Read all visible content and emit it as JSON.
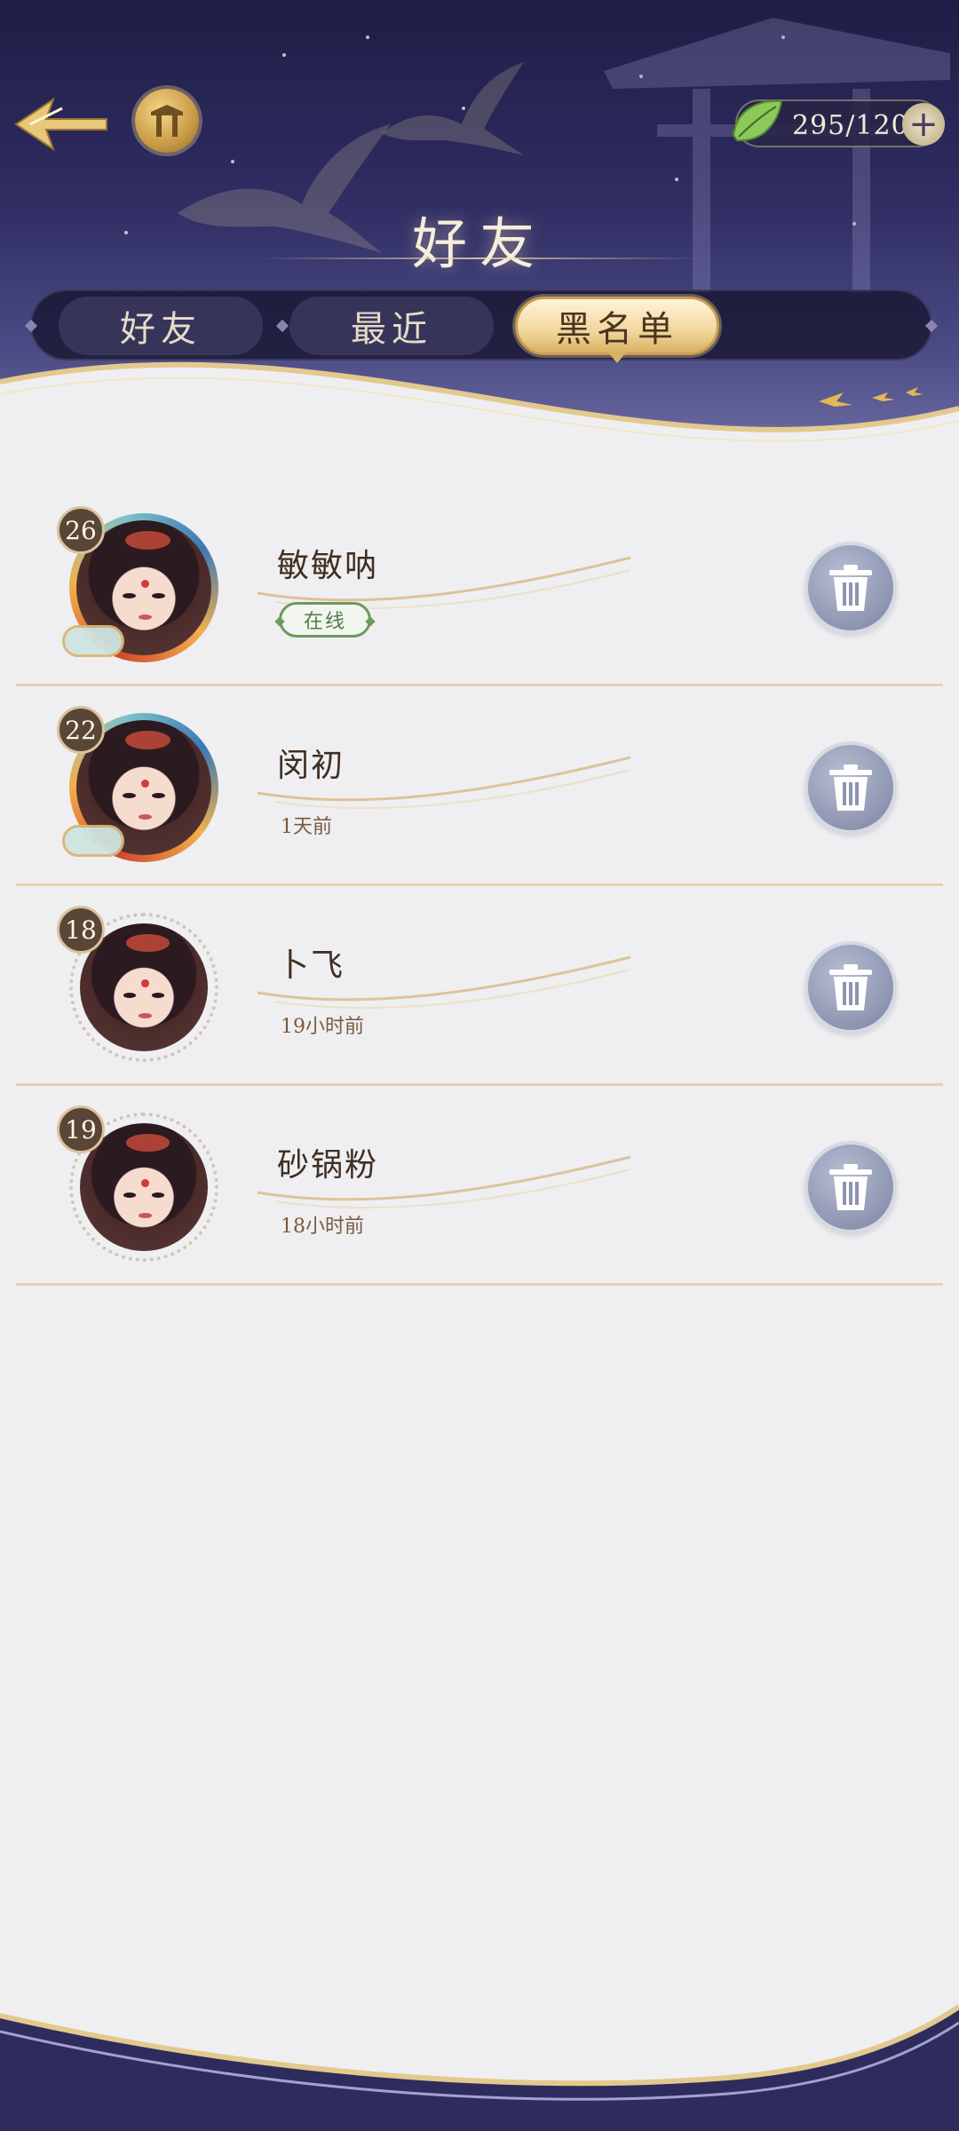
{
  "header": {
    "title": "好友",
    "currency": {
      "value": "295/120",
      "icon": "leaf-icon"
    }
  },
  "tabs": [
    {
      "label": "好友",
      "active": false
    },
    {
      "label": "最近",
      "active": false
    },
    {
      "label": "黑名单",
      "active": true
    }
  ],
  "blacklist": [
    {
      "level": "26",
      "name": "敏敏呐",
      "status": "在线",
      "online": true,
      "frame": "fancy"
    },
    {
      "level": "22",
      "name": "闵初",
      "status": "1天前",
      "online": false,
      "frame": "fancy"
    },
    {
      "level": "18",
      "name": "卜飞",
      "status": "19小时前",
      "online": false,
      "frame": "plain"
    },
    {
      "level": "19",
      "name": "砂锅粉",
      "status": "18小时前",
      "online": false,
      "frame": "plain"
    }
  ],
  "colors": {
    "header_bg": "#2f2d62",
    "list_bg": "#efeff2",
    "gold": "#d8b264",
    "online_green": "#6a9a5e",
    "trash_button": "#8d95b1"
  }
}
